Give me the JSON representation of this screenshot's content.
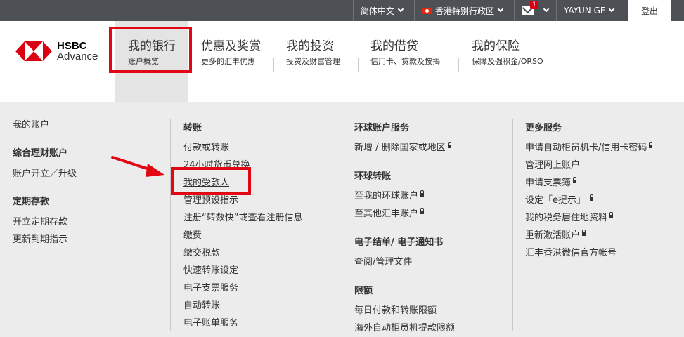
{
  "topbar": {
    "language": "简体中文",
    "region": "香港特别行政区",
    "mail_count": "1",
    "user": "YAYUN GE",
    "logout": "登出"
  },
  "brand": {
    "line1": "HSBC",
    "line2": "Advance"
  },
  "nav": [
    {
      "title": "我的银行",
      "sub": "账户概览"
    },
    {
      "title": "优惠及奖赏",
      "sub": "更多的汇丰优惠"
    },
    {
      "title": "我的投资",
      "sub": "投资及财富管理"
    },
    {
      "title": "我的借贷",
      "sub": "信用卡、贷款及按揭"
    },
    {
      "title": "我的保险",
      "sub": "保障及强积金/ORSO"
    }
  ],
  "menu": {
    "col1": {
      "item0": "我的账户",
      "head1": "综合理财账户",
      "item1": "账户开立／升级",
      "head2": "定期存款",
      "item2": "开立定期存款",
      "item3": "更新到期指示"
    },
    "col2": {
      "head": "转账",
      "items": [
        "付款或转账",
        "24小时货币兑换",
        "我的受款人",
        "管理预设指示",
        "注册“转数快”或查看注册信息",
        "缴费",
        "缴交税款",
        "快速转账设定",
        "电子支票服务",
        "自动转账",
        "电子账单服务"
      ]
    },
    "col3": {
      "head1": "环球账户服务",
      "item1": "新增 / 删除国家或地区",
      "head2": "环球转账",
      "item2": "至我的环球账户",
      "item3": "至其他汇丰账户",
      "head3": "电子结单/ 电子通知书",
      "item4": "查阅/管理文件",
      "head4": "限额",
      "item5": "每日付款和转账限额",
      "item6": "海外自动柜员机提款限额"
    },
    "col4": {
      "head": "更多服务",
      "items": [
        "申请自动柜员机卡/信用卡密码",
        "管理网上账户",
        "申请支票簿",
        "设定「e提示」",
        "我的税务居住地资料",
        "重新激活账户",
        "汇丰香港微信官方帐号"
      ]
    }
  },
  "colors": {
    "accent": "#db0011",
    "highlight": "#e30613",
    "topbar": "#4d5054",
    "menu_bg": "#ececec"
  }
}
